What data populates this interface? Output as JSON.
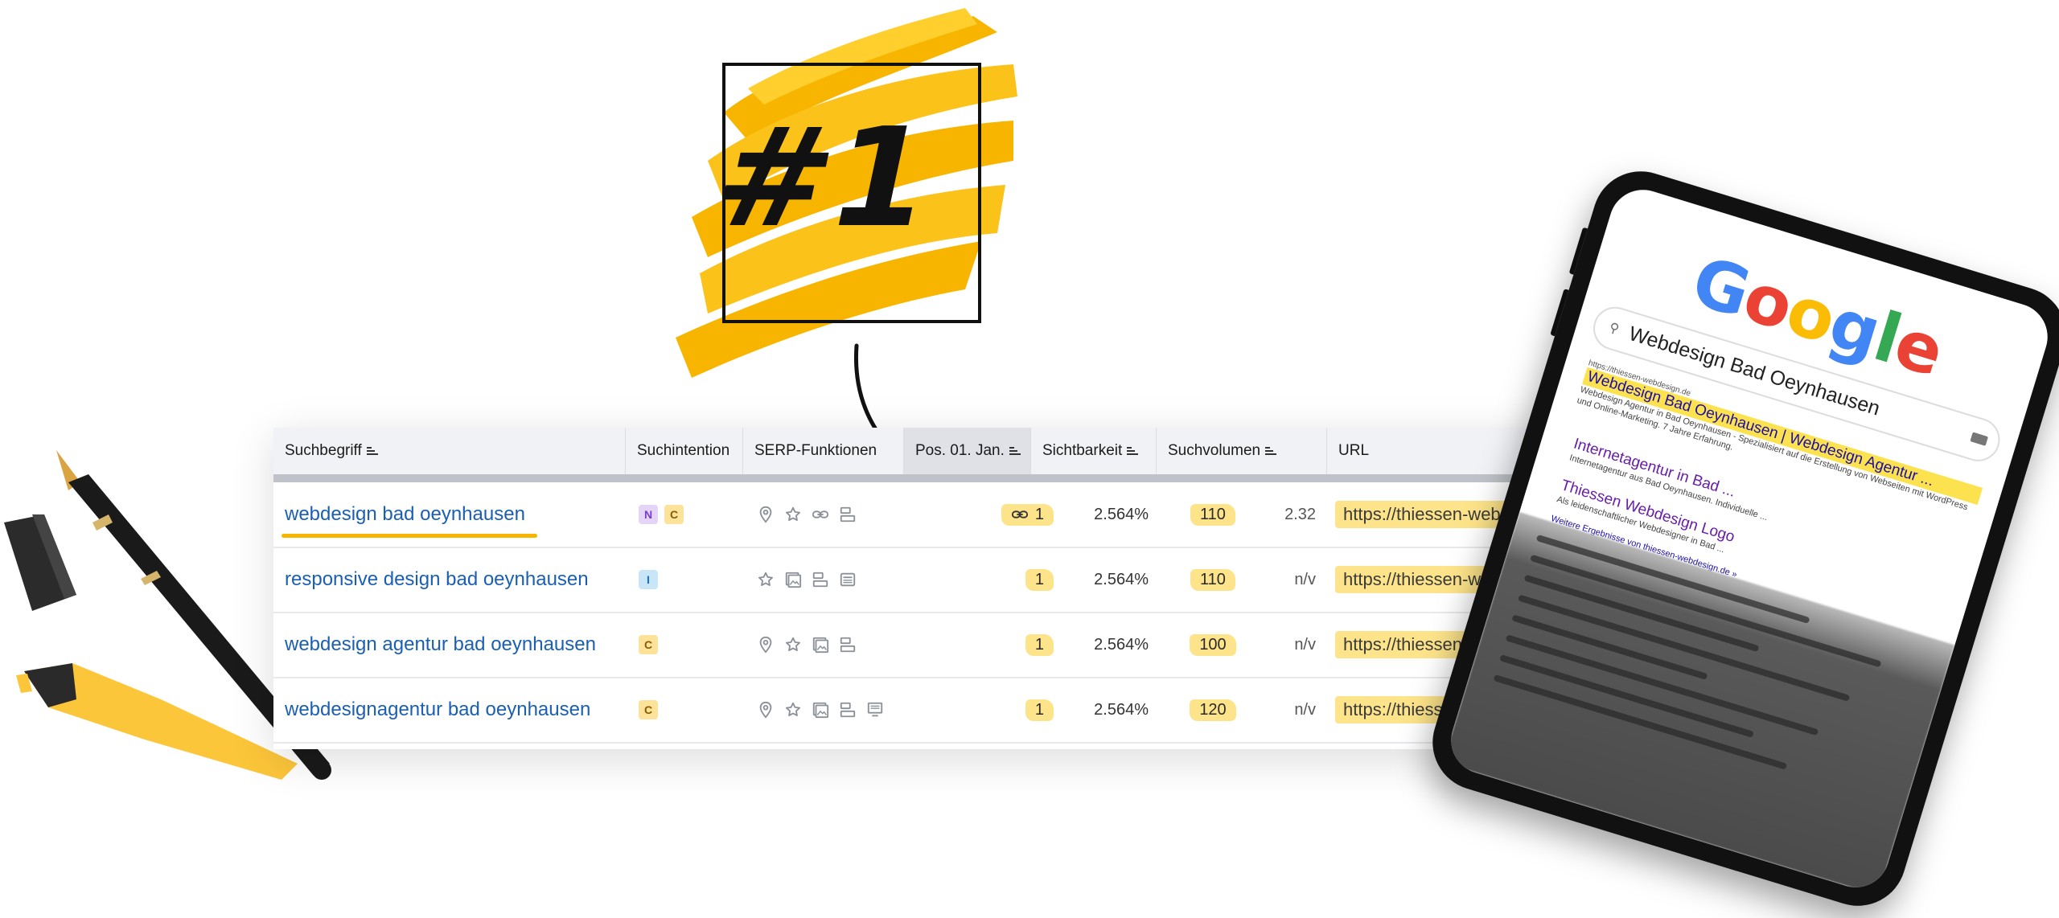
{
  "sticker": {
    "label": "#1",
    "color": "#f7b500"
  },
  "table": {
    "columns": [
      {
        "label": "Suchbegriff",
        "sortable": true
      },
      {
        "label": "Suchintention",
        "sortable": false
      },
      {
        "label": "SERP-Funktionen",
        "sortable": false
      },
      {
        "label": "Pos. 01. Jan.",
        "sortable": true,
        "sorted": true
      },
      {
        "label": "Sichtbarkeit",
        "sortable": true
      },
      {
        "label": "Suchvolumen",
        "sortable": true
      },
      {
        "label": "URL",
        "sortable": false
      }
    ],
    "rows": [
      {
        "keyword": "webdesign bad oeynhausen",
        "intents": [
          "N",
          "C"
        ],
        "serp": [
          "map-pin-icon",
          "star-icon",
          "link-icon",
          "layout-icon"
        ],
        "position": "1",
        "position_linked": true,
        "visibility": "2.564%",
        "volume": "110",
        "kd": "2.32",
        "url": "https://thiessen-webdes"
      },
      {
        "keyword": "responsive design bad oeynhausen",
        "intents": [
          "I"
        ],
        "serp": [
          "star-icon",
          "image-icon",
          "layout-icon",
          "newspaper-icon"
        ],
        "position": "1",
        "position_linked": false,
        "visibility": "2.564%",
        "volume": "110",
        "kd": "n/v",
        "url": "https://thiessen-webd"
      },
      {
        "keyword": "webdesign agentur bad oeynhausen",
        "intents": [
          "C"
        ],
        "serp": [
          "map-pin-icon",
          "star-icon",
          "image-icon",
          "layout-icon"
        ],
        "position": "1",
        "position_linked": false,
        "visibility": "2.564%",
        "volume": "100",
        "kd": "n/v",
        "url": "https://thiessen-we"
      },
      {
        "keyword": "webdesignagentur bad oeynhausen",
        "intents": [
          "C"
        ],
        "serp": [
          "map-pin-icon",
          "star-icon",
          "image-icon",
          "layout-icon",
          "monitor-icon"
        ],
        "position": "1",
        "position_linked": false,
        "visibility": "2.564%",
        "volume": "120",
        "kd": "n/v",
        "url": "https://thiessen-"
      }
    ]
  },
  "tablet": {
    "logo": "Google",
    "query": "Webdesign Bad Oeynhausen",
    "results": [
      {
        "url": "https://thiessen-webdesign.de",
        "title": "Webdesign Bad Oeynhausen | Webdesign Agentur ...",
        "snippet": "Webdesign Agentur in Bad Oeynhausen - Spezialisiert auf die Erstellung von Webseiten mit WordPress und Online-Marketing. 7 Jahre Erfahrung."
      },
      {
        "title": "Internetagentur in Bad ...",
        "snippet": "Internetagentur aus Bad Oeynhausen. Individuelle ..."
      },
      {
        "title": "Thiessen Webdesign Logo",
        "snippet": "Als leidenschaftlicher Webdesigner in Bad ..."
      }
    ],
    "more_link": "Weitere Ergebnisse von thiessen-webdesign.de »"
  },
  "colors": {
    "highlight": "#fde48a",
    "accent": "#f7b500",
    "link": "#1a5fb4"
  }
}
